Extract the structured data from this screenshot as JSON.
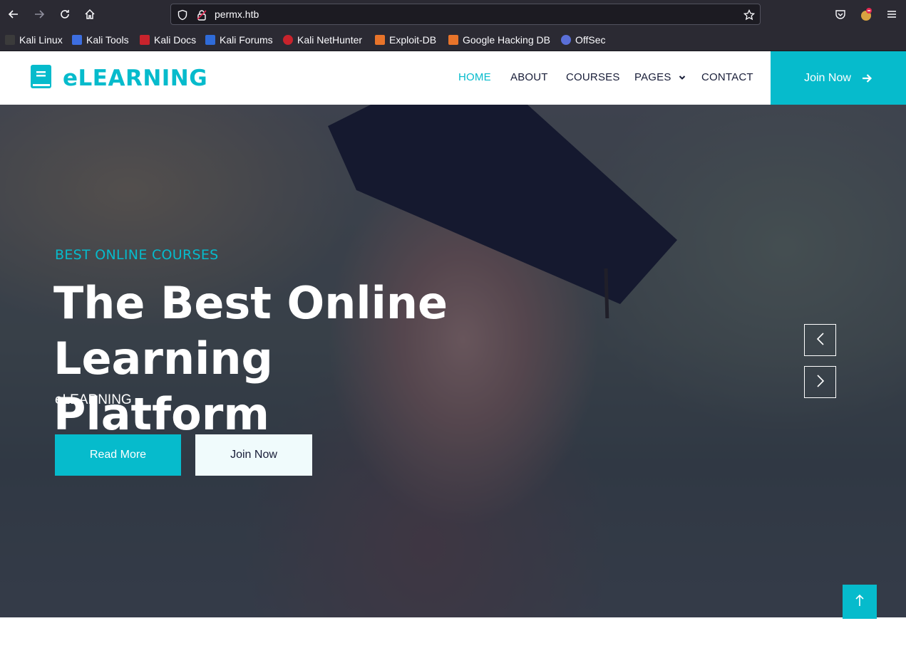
{
  "browser": {
    "url": "permx.htb",
    "bookmarks": [
      "Kali Linux",
      "Kali Tools",
      "Kali Docs",
      "Kali Forums",
      "Kali NetHunter",
      "Exploit-DB",
      "Google Hacking DB",
      "OffSec"
    ]
  },
  "header": {
    "logo_text": "eLEARNING",
    "menu": [
      "HOME",
      "ABOUT",
      "COURSES",
      "PAGES",
      "CONTACT"
    ],
    "active_menu": "HOME",
    "join_button": "Join Now"
  },
  "hero": {
    "subtitle": "BEST ONLINE COURSES",
    "title_line1": "The Best Online",
    "title_line2": "Learning Platform",
    "brand": "eLEARNING",
    "read_more": "Read More",
    "join_now": "Join Now"
  },
  "colors": {
    "accent": "#06bbcc",
    "dark": "#181d38",
    "browser_bg": "#2b2a33"
  },
  "icons": [
    "back-arrow-icon",
    "forward-arrow-icon",
    "reload-icon",
    "home-icon",
    "shield-icon",
    "lock-icon",
    "star-icon",
    "pocket-icon",
    "extension-icon",
    "menu-icon",
    "book-icon",
    "arrow-right-icon",
    "chevron-down-icon",
    "chevron-left-icon",
    "chevron-right-icon",
    "arrow-up-icon"
  ]
}
